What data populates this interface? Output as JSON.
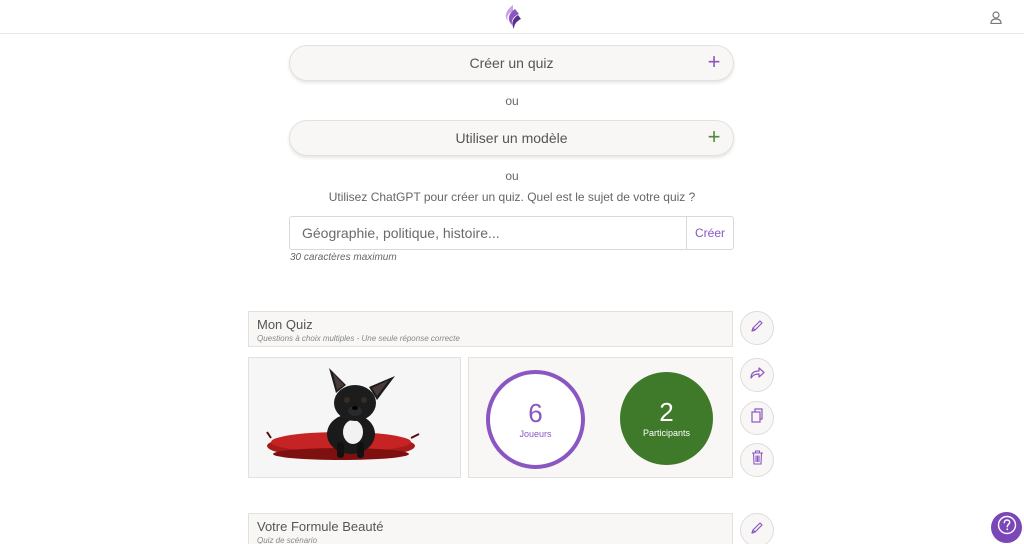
{
  "header": {
    "logo_icon": "brand-flame-logo",
    "user_icon": "user-icon"
  },
  "create": {
    "quiz_label": "Créer un quiz",
    "separator_1": "ou",
    "template_label": "Utiliser un modèle",
    "separator_2": "ou",
    "gpt_question": "Utilisez ChatGPT pour créer un quiz. Quel est le sujet de votre quiz ?",
    "gpt_placeholder": "Géographie, politique, histoire...",
    "gpt_button": "Créer",
    "gpt_hint": "30 caractères maximum",
    "plus_symbol": "+",
    "quiz_plus_color": "#8a56c2",
    "template_plus_color": "#4e8a3a"
  },
  "quizzes": [
    {
      "title": "Mon Quiz",
      "subtitle": "Questions à choix multiples - Une seule réponse correcte",
      "players_count": "6",
      "players_label": "Joueurs",
      "participants_count": "2",
      "participants_label": "Participants",
      "image_subject": "french-bulldog-on-red-cushion"
    },
    {
      "title": "Votre Formule Beauté",
      "subtitle": "Quiz de scénario"
    }
  ],
  "actions": [
    "edit-icon",
    "share-icon",
    "duplicate-icon",
    "delete-icon"
  ],
  "colors": {
    "accent_purple": "#8a56c2",
    "accent_green": "#3f7a2a"
  }
}
